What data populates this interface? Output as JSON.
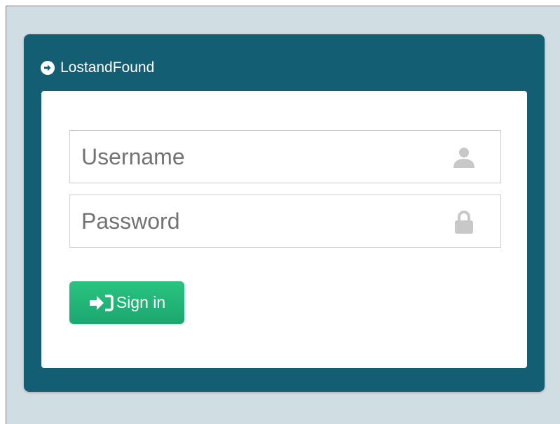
{
  "app": {
    "title": "LostandFound",
    "title_icon": "circle-arrow-right-icon"
  },
  "login_form": {
    "username": {
      "value": "",
      "placeholder": "Username",
      "icon": "user-icon"
    },
    "password": {
      "value": "",
      "placeholder": "Password",
      "icon": "lock-icon"
    },
    "submit": {
      "label": "Sign in",
      "icon": "sign-in-icon"
    }
  },
  "colors": {
    "page_background": "#d0dde2",
    "panel": "#145e73",
    "panel_body": "#ffffff",
    "button": "#1fb577",
    "field_icon": "#c8c8c8",
    "placeholder_text": "#737373"
  }
}
